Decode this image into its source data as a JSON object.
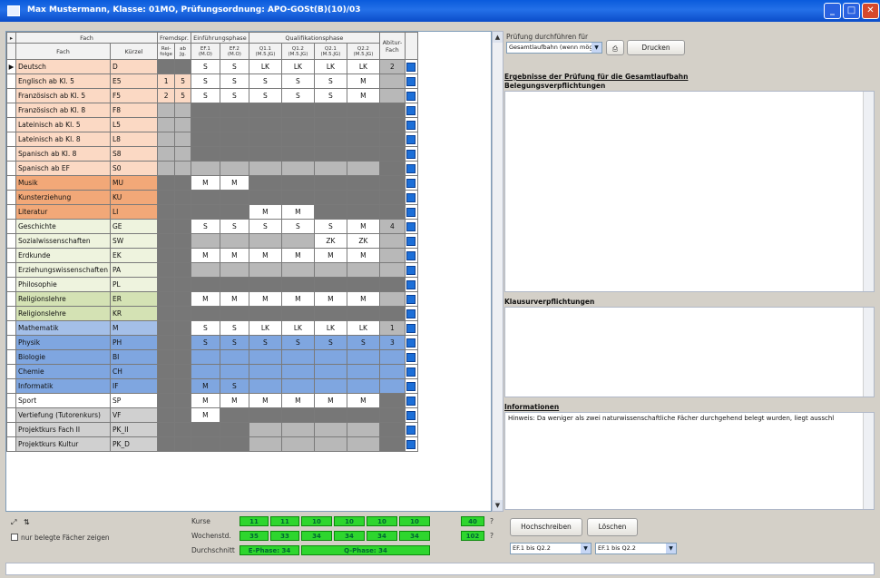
{
  "window": {
    "title": "Max Mustermann, Klasse: 01MO, Prüfungsordnung: APO-GOSt(B)(10)/03"
  },
  "grid": {
    "header": {
      "group_fach": "Fach",
      "group_fremd": "Fremdspr.",
      "group_einf": "Einführungsphase",
      "group_qual": "Qualifikationsphase",
      "group_abi": "Abitur-Fach",
      "col_fach": "Fach",
      "col_kurz": "Kürzel",
      "col_reihe": "Rei-folge",
      "col_abj": "ab Jg.",
      "col_ef1": "EF.1 (M.O)",
      "col_ef2": "EF.2 (M.O)",
      "col_q11": "Q1.1 (M.5.JG)",
      "col_q12": "Q1.2 (M.5.JG)",
      "col_q21": "Q2.1 (M.5.JG)",
      "col_q22": "Q2.2 (M.5.JG)"
    },
    "rows": [
      {
        "fach": "Deutsch",
        "kurz": "D",
        "bg": "#fbd9c4",
        "r": "",
        "a": "",
        "ef1": "S",
        "ef2": "S",
        "q11": "LK",
        "q12": "LK",
        "q21": "LK",
        "q22": "LK",
        "abi": "2",
        "pat": "ddwwwwwwL"
      },
      {
        "fach": "Englisch ab Kl. 5",
        "kurz": "E5",
        "bg": "#fbd9c4",
        "r": "1",
        "a": "5",
        "ef1": "S",
        "ef2": "S",
        "q11": "S",
        "q12": "S",
        "q21": "S",
        "q22": "M",
        "abi": "",
        "pat": "wwwwwwwwL"
      },
      {
        "fach": "Französisch ab Kl. 5",
        "kurz": "F5",
        "bg": "#fbd9c4",
        "r": "2",
        "a": "5",
        "ef1": "S",
        "ef2": "S",
        "q11": "S",
        "q12": "S",
        "q21": "S",
        "q22": "M",
        "abi": "",
        "pat": "wwwwwwwwL"
      },
      {
        "fach": "Französisch ab Kl. 8",
        "kurz": "F8",
        "bg": "#fbd9c4",
        "r": "",
        "a": "",
        "ef1": "",
        "ef2": "",
        "q11": "",
        "q12": "",
        "q21": "",
        "q22": "",
        "abi": "",
        "pat": "LLddddddd"
      },
      {
        "fach": "Lateinisch ab Kl. 5",
        "kurz": "L5",
        "bg": "#fbd9c4",
        "r": "",
        "a": "",
        "ef1": "",
        "ef2": "",
        "q11": "",
        "q12": "",
        "q21": "",
        "q22": "",
        "abi": "",
        "pat": "LLddddddd"
      },
      {
        "fach": "Lateinisch ab Kl. 8",
        "kurz": "L8",
        "bg": "#fbd9c4",
        "r": "",
        "a": "",
        "ef1": "",
        "ef2": "",
        "q11": "",
        "q12": "",
        "q21": "",
        "q22": "",
        "abi": "",
        "pat": "LLddddddd"
      },
      {
        "fach": "Spanisch ab Kl. 8",
        "kurz": "S8",
        "bg": "#fbd9c4",
        "r": "",
        "a": "",
        "ef1": "",
        "ef2": "",
        "q11": "",
        "q12": "",
        "q21": "",
        "q22": "",
        "abi": "",
        "pat": "LLddddddd"
      },
      {
        "fach": "Spanisch ab EF",
        "kurz": "S0",
        "bg": "#fbd9c4",
        "r": "",
        "a": "",
        "ef1": "",
        "ef2": "",
        "q11": "",
        "q12": "",
        "q21": "",
        "q22": "",
        "abi": "",
        "pat": "LLLLLLLLd"
      },
      {
        "fach": "Musik",
        "kurz": "MU",
        "bg": "#f2a878",
        "r": "",
        "a": "",
        "ef1": "M",
        "ef2": "M",
        "q11": "",
        "q12": "",
        "q21": "",
        "q22": "",
        "abi": "",
        "pat": "ddwwdddd d"
      },
      {
        "fach": "Kunsterziehung",
        "kurz": "KU",
        "bg": "#f2a878",
        "r": "",
        "a": "",
        "ef1": "",
        "ef2": "",
        "q11": "",
        "q12": "",
        "q21": "",
        "q22": "",
        "abi": "",
        "pat": "ddddddddd"
      },
      {
        "fach": "Literatur",
        "kurz": "LI",
        "bg": "#f2a878",
        "r": "",
        "a": "",
        "ef1": "",
        "ef2": "",
        "q11": "M",
        "q12": "M",
        "q21": "",
        "q22": "",
        "abi": "",
        "pat": "dddd wwddd"
      },
      {
        "fach": "Geschichte",
        "kurz": "GE",
        "bg": "#eef3de",
        "r": "",
        "a": "",
        "ef1": "S",
        "ef2": "S",
        "q11": "S",
        "q12": "S",
        "q21": "S",
        "q22": "M",
        "abi": "4",
        "pat": "ddwwwwwwL"
      },
      {
        "fach": "Sozialwissenschaften",
        "kurz": "SW",
        "bg": "#eef3de",
        "r": "",
        "a": "",
        "ef1": "",
        "ef2": "",
        "q11": "",
        "q12": "",
        "q21": "ZK",
        "q22": "ZK",
        "abi": "",
        "pat": "ddLLLLwwL"
      },
      {
        "fach": "Erdkunde",
        "kurz": "EK",
        "bg": "#eef3de",
        "r": "",
        "a": "",
        "ef1": "M",
        "ef2": "M",
        "q11": "M",
        "q12": "M",
        "q21": "M",
        "q22": "M",
        "abi": "",
        "pat": "ddwwwwwwL"
      },
      {
        "fach": "Erziehungswissenschaften",
        "kurz": "PA",
        "bg": "#eef3de",
        "r": "",
        "a": "",
        "ef1": "",
        "ef2": "",
        "q11": "",
        "q12": "",
        "q21": "",
        "q22": "",
        "abi": "",
        "pat": "ddLLLLLLL"
      },
      {
        "fach": "Philosophie",
        "kurz": "PL",
        "bg": "#eef3de",
        "r": "",
        "a": "",
        "ef1": "",
        "ef2": "",
        "q11": "",
        "q12": "",
        "q21": "",
        "q22": "",
        "abi": "",
        "pat": "ddddddddd"
      },
      {
        "fach": "Religionslehre",
        "kurz": "ER",
        "bg": "#d4e2b4",
        "r": "",
        "a": "",
        "ef1": "M",
        "ef2": "M",
        "q11": "M",
        "q12": "M",
        "q21": "M",
        "q22": "M",
        "abi": "",
        "pat": "ddwwwwwwL"
      },
      {
        "fach": "Religionslehre",
        "kurz": "KR",
        "bg": "#d4e2b4",
        "r": "",
        "a": "",
        "ef1": "",
        "ef2": "",
        "q11": "",
        "q12": "",
        "q21": "",
        "q22": "",
        "abi": "",
        "pat": "ddddddddd"
      },
      {
        "fach": "Mathematik",
        "kurz": "M",
        "bg": "#a4bfe8",
        "r": "",
        "a": "",
        "ef1": "S",
        "ef2": "S",
        "q11": "LK",
        "q12": "LK",
        "q21": "LK",
        "q22": "LK",
        "abi": "1",
        "pat": "ddwwwwwwL"
      },
      {
        "fach": "Physik",
        "kurz": "PH",
        "bg": "#7fa6e0",
        "r": "",
        "a": "",
        "ef1": "S",
        "ef2": "S",
        "q11": "S",
        "q12": "S",
        "q21": "S",
        "q22": "S",
        "abi": "3",
        "pat": "ddbbbbbbb"
      },
      {
        "fach": "Biologie",
        "kurz": "BI",
        "bg": "#7fa6e0",
        "r": "",
        "a": "",
        "ef1": "",
        "ef2": "",
        "q11": "",
        "q12": "",
        "q21": "",
        "q22": "",
        "abi": "",
        "pat": "ddbbbbbbb"
      },
      {
        "fach": "Chemie",
        "kurz": "CH",
        "bg": "#7fa6e0",
        "r": "",
        "a": "",
        "ef1": "",
        "ef2": "",
        "q11": "",
        "q12": "",
        "q21": "",
        "q22": "",
        "abi": "",
        "pat": "ddbbbbbbb"
      },
      {
        "fach": "Informatik",
        "kurz": "IF",
        "bg": "#7fa6e0",
        "r": "",
        "a": "",
        "ef1": "M",
        "ef2": "S",
        "q11": "",
        "q12": "",
        "q21": "",
        "q22": "",
        "abi": "",
        "pat": "ddbbbbbbb"
      },
      {
        "fach": "Sport",
        "kurz": "SP",
        "bg": "#ffffff",
        "r": "",
        "a": "",
        "ef1": "M",
        "ef2": "M",
        "q11": "M",
        "q12": "M",
        "q21": "M",
        "q22": "M",
        "abi": "",
        "pat": "ddwwwwwwd"
      },
      {
        "fach": "Vertiefung (Tutorenkurs)",
        "kurz": "VF",
        "bg": "#d0d0d0",
        "r": "",
        "a": "",
        "ef1": "M",
        "ef2": "",
        "q11": "",
        "q12": "",
        "q21": "",
        "q22": "",
        "abi": "",
        "pat": "ddwddd ddd"
      },
      {
        "fach": "Projektkurs Fach II",
        "kurz": "PK_II",
        "bg": "#d0d0d0",
        "r": "",
        "a": "",
        "ef1": "",
        "ef2": "",
        "q11": "",
        "q12": "",
        "q21": "",
        "q22": "",
        "abi": "",
        "pat": "ddddLLLLd"
      },
      {
        "fach": "Projektkurs Kultur",
        "kurz": "PK_D",
        "bg": "#d0d0d0",
        "r": "",
        "a": "",
        "ef1": "",
        "ef2": "",
        "q11": "",
        "q12": "",
        "q21": "",
        "q22": "",
        "abi": "",
        "pat": "ddddLLLLd"
      }
    ]
  },
  "bottom": {
    "filter_label": "nur belegte Fächer zeigen",
    "kurse_label": "Kurse",
    "wochenstd_label": "Wochenstd.",
    "durchschnitt_label": "Durchschnitt",
    "kurse": [
      "11",
      "11",
      "10",
      "10",
      "10",
      "10"
    ],
    "kurse_total": "40",
    "wochenstd": [
      "35",
      "33",
      "34",
      "34",
      "34",
      "34"
    ],
    "wochenstd_total": "102",
    "e_phase": "E-Phase: 34",
    "q_phase": "Q-Phase: 34",
    "question_a": "?",
    "question_b": "?",
    "hochschreiben": "Hochschreiben",
    "loeschen": "Löschen",
    "range_from": "EF.1 bis Q2.2",
    "range_to": "EF.1 bis Q2.2"
  },
  "right": {
    "pruefung_label": "Prüfung durchführen für",
    "pruefung_value": "Gesamtlaufbahn (wenn mögl.)",
    "drucken_label": "Drucken",
    "ergebnis_title": "Ergebnisse der Prüfung für die Gesamtlaufbahn",
    "belegung_title": "Belegungsverpflichtungen",
    "klausur_title": "Klausurverpflichtungen",
    "info_title": "Informationen",
    "info_text": "Hinweis: Da weniger als zwei naturwissenschaftliche Fächer durchgehend belegt wurden, liegt ausschl"
  }
}
